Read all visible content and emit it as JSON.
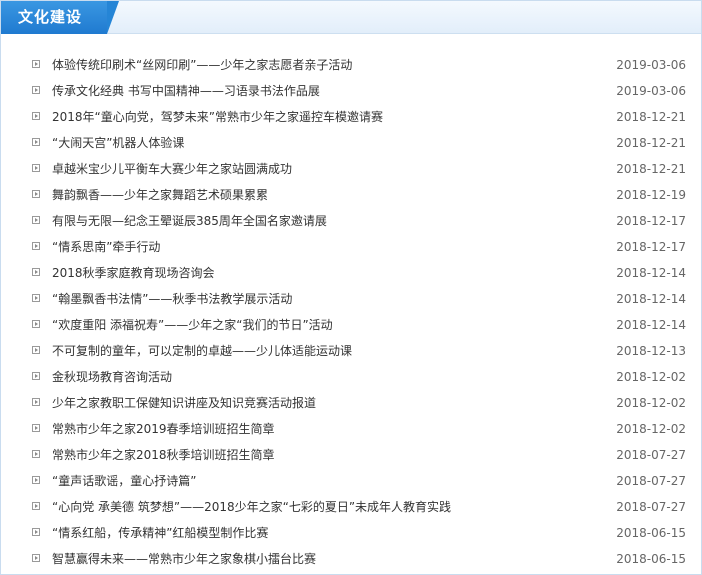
{
  "header": {
    "title": "文化建设"
  },
  "items": [
    {
      "title": "体验传统印刷术“丝网印刷”——少年之家志愿者亲子活动",
      "date": "2019-03-06"
    },
    {
      "title": "传承文化经典 书写中国精神——习语录书法作品展",
      "date": "2019-03-06"
    },
    {
      "title": "2018年“童心向党，驾梦未来”常熟市少年之家遥控车模邀请赛",
      "date": "2018-12-21"
    },
    {
      "title": "“大闹天宫”机器人体验课",
      "date": "2018-12-21"
    },
    {
      "title": "卓越米宝少儿平衡车大赛少年之家站圆满成功",
      "date": "2018-12-21"
    },
    {
      "title": "舞韵飘香——少年之家舞蹈艺术硕果累累",
      "date": "2018-12-19"
    },
    {
      "title": "有限与无限—纪念王翚诞辰385周年全国名家邀请展",
      "date": "2018-12-17"
    },
    {
      "title": "“情系思南”牵手行动",
      "date": "2018-12-17"
    },
    {
      "title": "2018秋季家庭教育现场咨询会",
      "date": "2018-12-14"
    },
    {
      "title": "“翰墨飘香书法情”——秋季书法教学展示活动",
      "date": "2018-12-14"
    },
    {
      "title": "“欢度重阳 添福祝寿”——少年之家“我们的节日”活动",
      "date": "2018-12-14"
    },
    {
      "title": "不可复制的童年，可以定制的卓越——少儿体适能运动课",
      "date": "2018-12-13"
    },
    {
      "title": "金秋现场教育咨询活动",
      "date": "2018-12-02"
    },
    {
      "title": "少年之家教职工保健知识讲座及知识竞赛活动报道",
      "date": "2018-12-02"
    },
    {
      "title": "常熟市少年之家2019春季培训班招生简章",
      "date": "2018-12-02"
    },
    {
      "title": "常熟市少年之家2018秋季培训班招生简章",
      "date": "2018-07-27"
    },
    {
      "title": "“童声话歌谣，童心抒诗篇”",
      "date": "2018-07-27"
    },
    {
      "title": "“心向党 承美德 筑梦想”——2018少年之家“七彩的夏日”未成年人教育实践",
      "date": "2018-07-27"
    },
    {
      "title": "“情系红船，传承精神”红船模型制作比赛",
      "date": "2018-06-15"
    },
    {
      "title": "智慧赢得未来——常熟市少年之家象棋小擂台比赛",
      "date": "2018-06-15"
    }
  ]
}
